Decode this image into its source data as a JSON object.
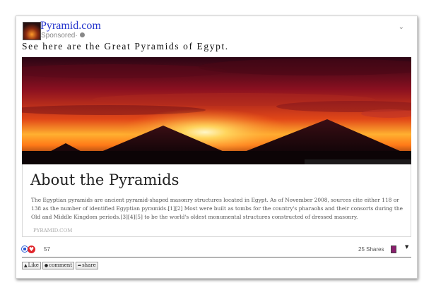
{
  "post": {
    "site_name": "Pyramid.com",
    "sponsored_label": "Sponsored",
    "separator": "·",
    "menu_icon": "chevron-down-icon",
    "caption": "See here are the Great Pyramids of Egypt."
  },
  "hero_image": {
    "subject": "pyramids-at-sunset"
  },
  "article": {
    "title": "About the Pyramids",
    "body": "The Egyptian pyramids are ancient pyramid-shaped masonry structures located in Egypt. As of November 2008, sources cite either 118 or 138 as the number of identified Egyptian pyramids.[1][2] Most were built as tombs for the country's pharaohs and their consorts during the Old and Middle Kingdom periods.[3][4][5] to be the world's oldest monumental structures constructed of dressed masonry.",
    "domain": "PYRAMID.COM"
  },
  "engagement": {
    "reaction_count": "57",
    "shares": "25 Shares",
    "like_color": "#2b5cd6",
    "heart_color": "#e0252b"
  },
  "actions": [
    {
      "label": "Like",
      "icon": "thumbs-up-icon"
    },
    {
      "label": "comment",
      "icon": "speech-bubble-icon"
    },
    {
      "label": "share",
      "icon": "share-arrow-icon"
    }
  ]
}
